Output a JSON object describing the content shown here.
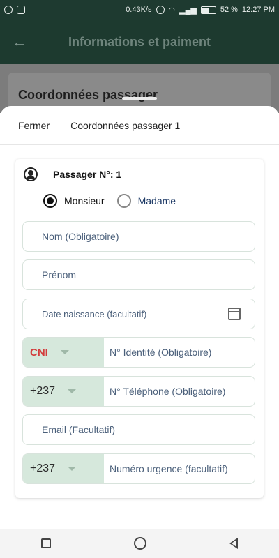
{
  "status_bar": {
    "speed": "0.43K/s",
    "battery": "52 %",
    "time": "12:27 PM"
  },
  "app_bar": {
    "back_icon": "arrow-left-icon",
    "title": "Informations et paiment"
  },
  "background": {
    "section_title": "Coordonnées passager"
  },
  "sheet": {
    "close_label": "Fermer",
    "title": "Coordonnées passager 1",
    "passenger_label": "Passager N°: 1",
    "gender": {
      "options": [
        "Monsieur",
        "Madame"
      ],
      "selected": "Monsieur"
    },
    "fields": {
      "nom": "Nom (Obligatoire)",
      "prenom": "Prénom",
      "date": "Date naissance (facultatif)",
      "id_type": "CNI",
      "id_number": "N° Identité (Obligatoire)",
      "phone_code": "+237",
      "phone": "N° Téléphone (Obligatoire)",
      "email": "Email (Facultatif)",
      "urgence_code": "+237",
      "urgence": "Numéro urgence (facultatif)"
    }
  },
  "colors": {
    "app_bar": "#1d3a2f",
    "prefix_bg": "#d6e8dc",
    "cni_red": "#d33b3b"
  }
}
